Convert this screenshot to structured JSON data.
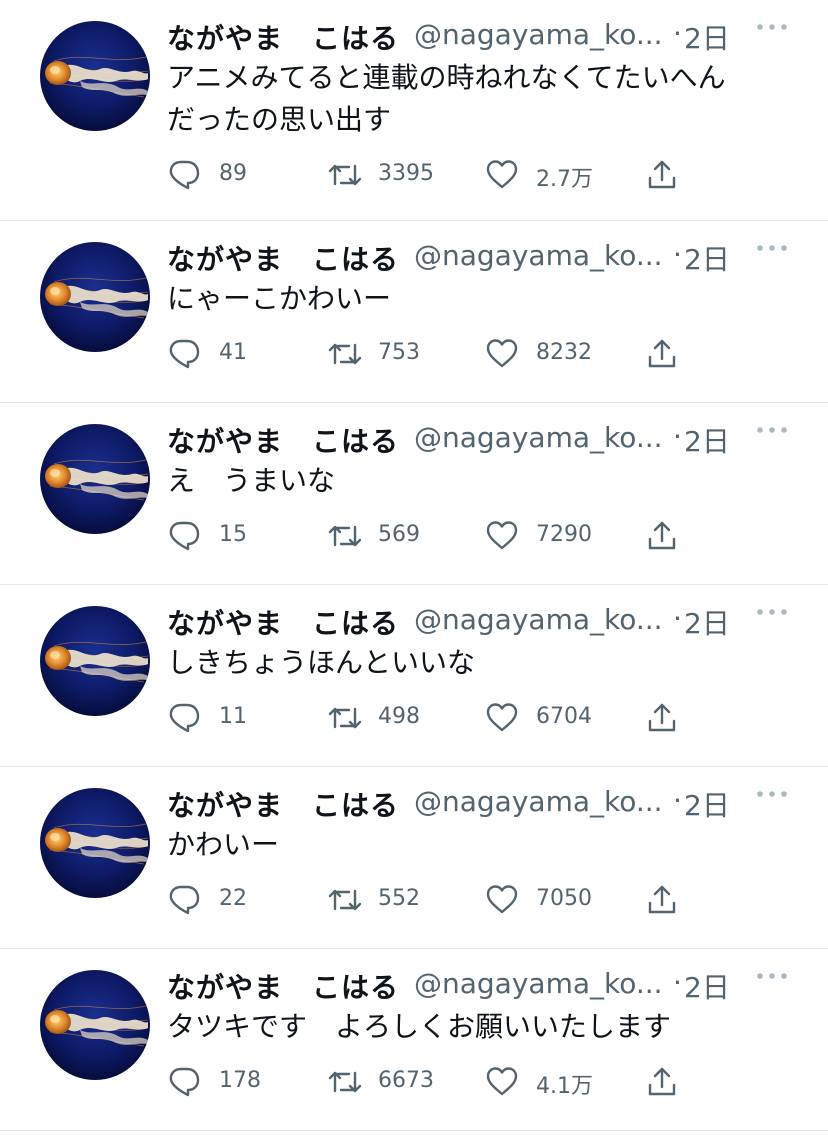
{
  "colors": {
    "text": "#0f1419",
    "muted": "#536471",
    "divider": "#e1e6ea"
  },
  "icons": {
    "reply": "speech-bubble-icon",
    "retweet": "retweet-icon",
    "like": "heart-icon",
    "share": "share-upload-icon",
    "more": "more-dots-icon"
  },
  "tweets": [
    {
      "name": "ながやま　こはる",
      "handle": "@nagayama_ko...",
      "sep": "·",
      "time": "2日",
      "lines": [
        "アニメみてると連載の時ねれなくてたいへん",
        "だったの思い出す"
      ],
      "replies": "89",
      "retweets": "3395",
      "likes": "2.7万"
    },
    {
      "name": "ながやま　こはる",
      "handle": "@nagayama_ko...",
      "sep": "·",
      "time": "2日",
      "lines": [
        "にゃーこかわいー"
      ],
      "replies": "41",
      "retweets": "753",
      "likes": "8232"
    },
    {
      "name": "ながやま　こはる",
      "handle": "@nagayama_ko...",
      "sep": "·",
      "time": "2日",
      "lines": [
        "え　うまいな"
      ],
      "replies": "15",
      "retweets": "569",
      "likes": "7290"
    },
    {
      "name": "ながやま　こはる",
      "handle": "@nagayama_ko...",
      "sep": "·",
      "time": "2日",
      "lines": [
        "しきちょうほんといいな"
      ],
      "replies": "11",
      "retweets": "498",
      "likes": "6704"
    },
    {
      "name": "ながやま　こはる",
      "handle": "@nagayama_ko...",
      "sep": "·",
      "time": "2日",
      "lines": [
        "かわいー"
      ],
      "replies": "22",
      "retweets": "552",
      "likes": "7050"
    },
    {
      "name": "ながやま　こはる",
      "handle": "@nagayama_ko...",
      "sep": "·",
      "time": "2日",
      "lines": [
        "タツキです　よろしくお願いいたします"
      ],
      "replies": "178",
      "retweets": "6673",
      "likes": "4.1万"
    }
  ]
}
